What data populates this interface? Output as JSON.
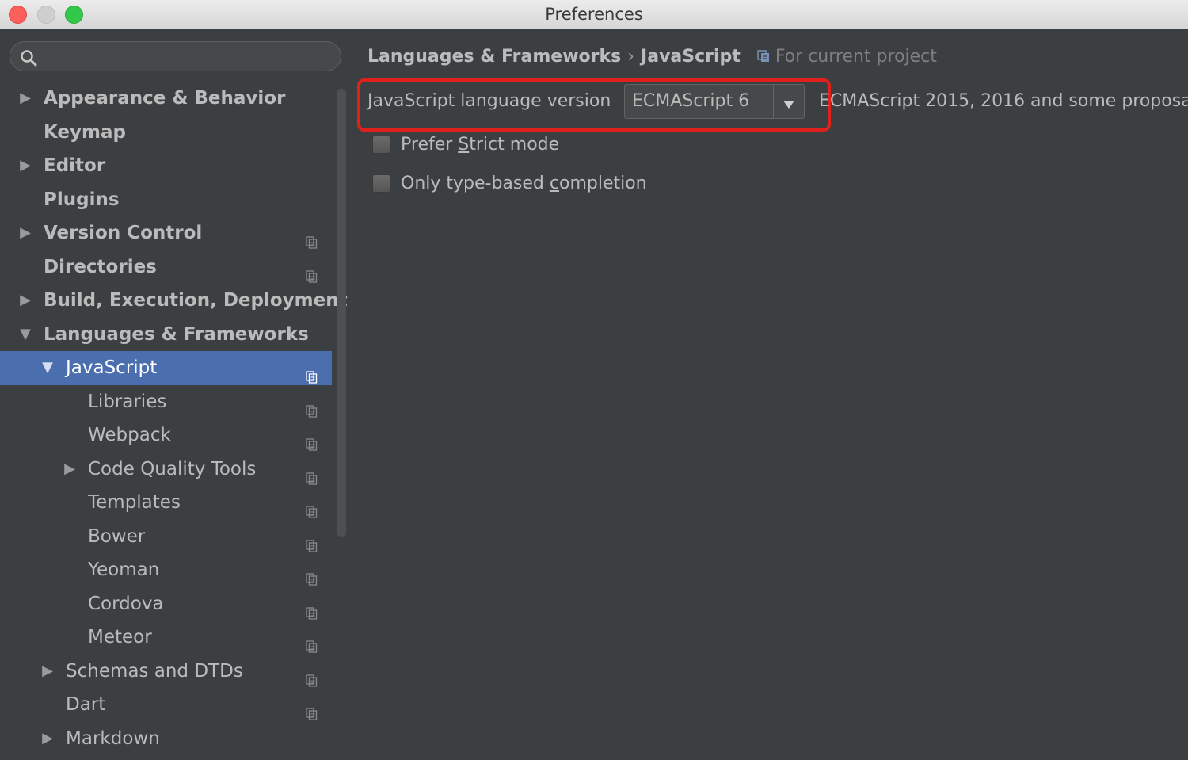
{
  "window": {
    "title": "Preferences"
  },
  "search": {
    "placeholder": ""
  },
  "tree": [
    {
      "label": "Appearance & Behavior",
      "level": 0,
      "expand": "collapsed",
      "bold": true,
      "project": false
    },
    {
      "label": "Keymap",
      "level": 0,
      "expand": "none",
      "bold": true,
      "project": false
    },
    {
      "label": "Editor",
      "level": 0,
      "expand": "collapsed",
      "bold": true,
      "project": false
    },
    {
      "label": "Plugins",
      "level": 0,
      "expand": "none",
      "bold": true,
      "project": false
    },
    {
      "label": "Version Control",
      "level": 0,
      "expand": "collapsed",
      "bold": true,
      "project": true
    },
    {
      "label": "Directories",
      "level": 0,
      "expand": "none",
      "bold": true,
      "project": true
    },
    {
      "label": "Build, Execution, Deployment",
      "level": 0,
      "expand": "collapsed",
      "bold": true,
      "project": false
    },
    {
      "label": "Languages & Frameworks",
      "level": 0,
      "expand": "expanded",
      "bold": true,
      "project": false
    },
    {
      "label": "JavaScript",
      "level": 1,
      "expand": "expanded",
      "bold": false,
      "project": true,
      "selected": true
    },
    {
      "label": "Libraries",
      "level": 2,
      "expand": "none",
      "bold": false,
      "project": true
    },
    {
      "label": "Webpack",
      "level": 2,
      "expand": "none",
      "bold": false,
      "project": true
    },
    {
      "label": "Code Quality Tools",
      "level": 2,
      "expand": "collapsed",
      "bold": false,
      "project": true
    },
    {
      "label": "Templates",
      "level": 2,
      "expand": "none",
      "bold": false,
      "project": true
    },
    {
      "label": "Bower",
      "level": 2,
      "expand": "none",
      "bold": false,
      "project": true
    },
    {
      "label": "Yeoman",
      "level": 2,
      "expand": "none",
      "bold": false,
      "project": true
    },
    {
      "label": "Cordova",
      "level": 2,
      "expand": "none",
      "bold": false,
      "project": true
    },
    {
      "label": "Meteor",
      "level": 2,
      "expand": "none",
      "bold": false,
      "project": true
    },
    {
      "label": "Schemas and DTDs",
      "level": 1,
      "expand": "collapsed",
      "bold": false,
      "project": true
    },
    {
      "label": "Dart",
      "level": 1,
      "expand": "none",
      "bold": false,
      "project": true
    },
    {
      "label": "Markdown",
      "level": 1,
      "expand": "collapsed",
      "bold": false,
      "project": false
    }
  ],
  "breadcrumb": {
    "parent": "Languages & Frameworks",
    "separator": "›",
    "current": "JavaScript",
    "scope": "For current project"
  },
  "settings": {
    "language_version_label": "JavaScript language version",
    "language_version_value": "ECMAScript 6",
    "language_version_description": "ECMAScript 2015, 2016 and some proposa",
    "prefer_strict": {
      "before": "Prefer ",
      "mnemonic": "S",
      "after": "trict mode",
      "checked": false
    },
    "type_completion": {
      "before": "Only type-based ",
      "mnemonic": "c",
      "after": "ompletion",
      "checked": false
    }
  },
  "colors": {
    "selection": "#4b6eaf",
    "highlight_box": "#e0211b",
    "panel_bg": "#3c3f41"
  },
  "icons": {
    "search": "search-icon",
    "expand_collapsed": "chevron-right-icon",
    "expand_expanded": "chevron-down-icon",
    "project_scope": "project-scope-icon",
    "dropdown": "dropdown-caret-icon"
  }
}
